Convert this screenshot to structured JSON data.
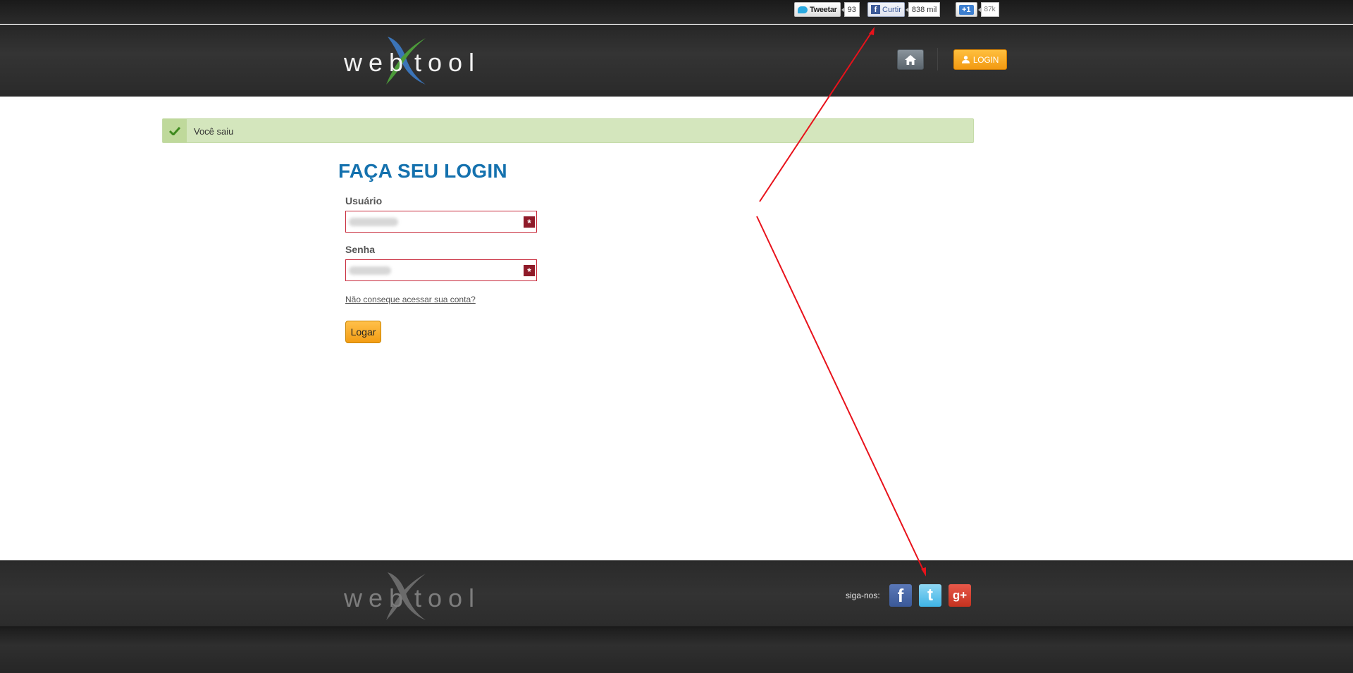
{
  "social_bar": {
    "tweet": {
      "label": "Tweetar",
      "count": "93"
    },
    "facebook": {
      "label": "Curtir",
      "count": "838 mil"
    },
    "gplus": {
      "label": "+1",
      "count": "87k"
    }
  },
  "header": {
    "logo": "webxtool",
    "login_label": "LOGIN"
  },
  "alert": {
    "text": "Você saiu"
  },
  "form": {
    "title": "FAÇA SEU LOGIN",
    "username_label": "Usuário",
    "password_label": "Senha",
    "forgot_link": "Não conseque acessar sua conta?",
    "submit_label": "Logar"
  },
  "footer": {
    "logo": "webxtool",
    "follow_label": "siga-nos:"
  },
  "colors": {
    "accent_orange": "#f5a623",
    "title_blue": "#1471ae",
    "alert_green": "#d4e6bd",
    "required_red": "#8f1b29",
    "annotation_red": "#e8121b"
  }
}
